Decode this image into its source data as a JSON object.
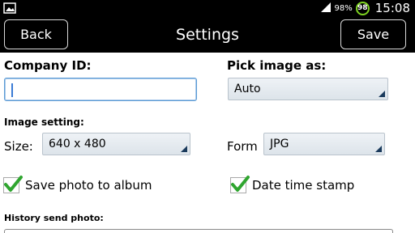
{
  "statusbar": {
    "battery_pct": "98%",
    "notification_badge": "98",
    "time": "15:08",
    "left_icon": "image-icon",
    "right_icons": [
      "signal-icon",
      "battery-circle-icon"
    ]
  },
  "actionbar": {
    "back_label": "Back",
    "title": "Settings",
    "save_label": "Save"
  },
  "form": {
    "company_id_label": "Company ID:",
    "company_id_value": "",
    "pick_image_label": "Pick image as:",
    "pick_image_value": "Auto",
    "image_setting_label": "Image setting:",
    "size_label": "Size:",
    "size_value": "640 x 480",
    "form_label": "Form",
    "form_value": "JPG",
    "save_photo_label": "Save photo to album",
    "save_photo_checked": true,
    "date_stamp_label": "Date time stamp",
    "date_stamp_checked": true,
    "history_label": "History send photo:"
  },
  "colors": {
    "check_green": "#2fa52f",
    "accent_blue": "#3a7bd5",
    "battery_green": "#7ed321"
  }
}
